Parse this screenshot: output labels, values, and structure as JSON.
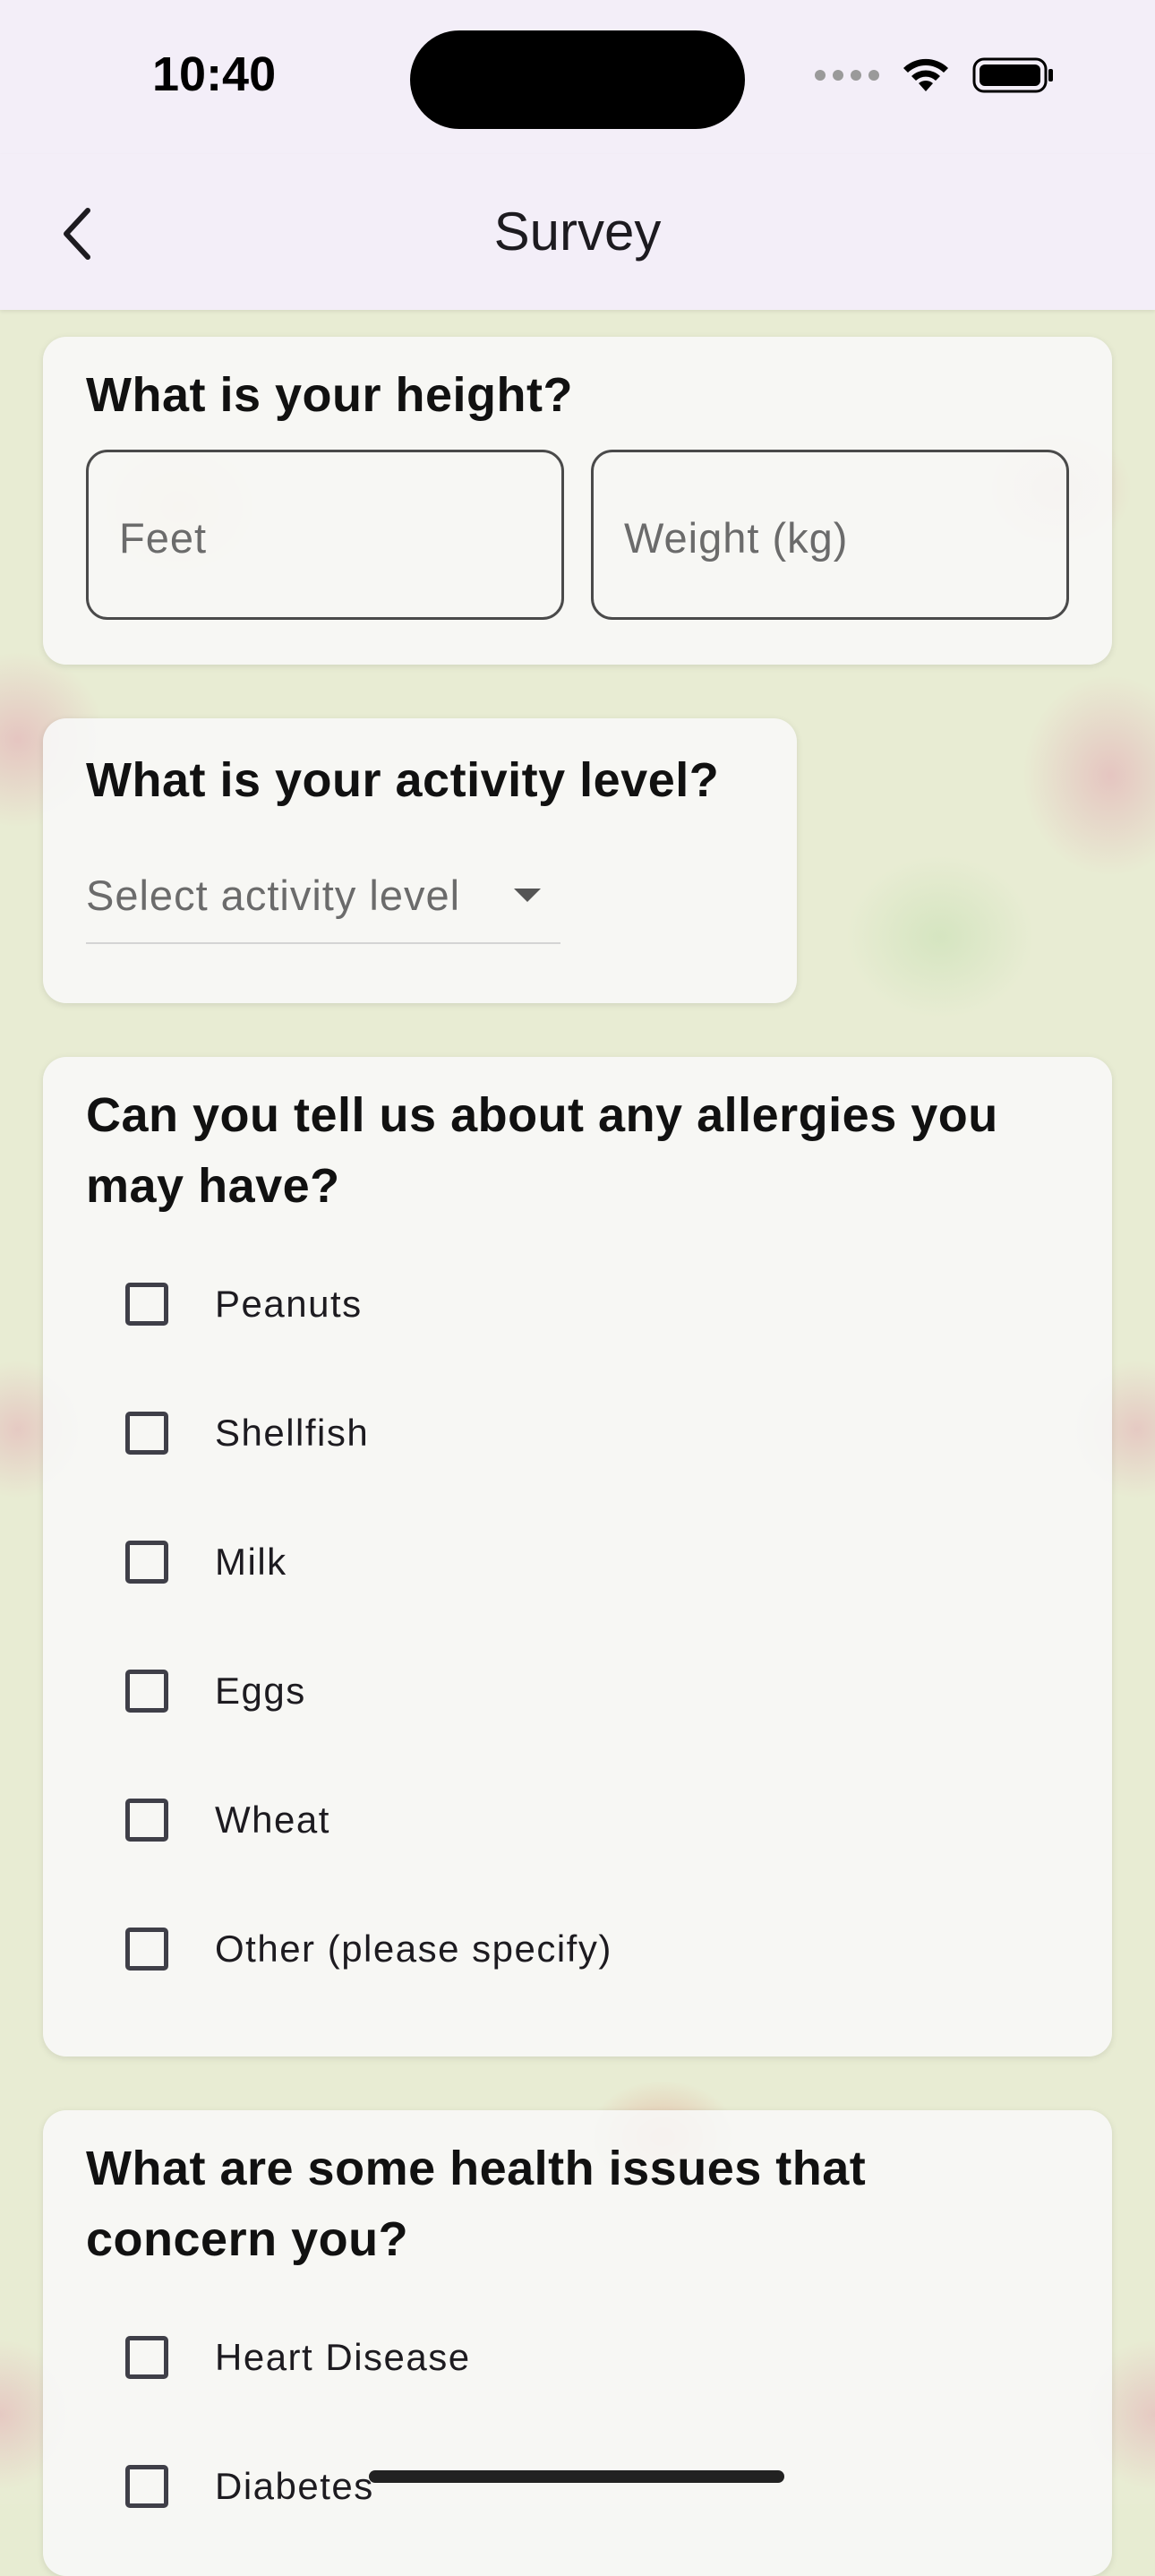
{
  "status": {
    "time": "10:40"
  },
  "nav": {
    "title": "Survey"
  },
  "height_card": {
    "question": "What is your height?",
    "feet_placeholder": "Feet",
    "weight_placeholder": "Weight (kg)"
  },
  "activity_card": {
    "question": "What is your activity level?",
    "dropdown_placeholder": "Select activity level"
  },
  "allergies_card": {
    "question_line1": "Can you tell us about any allergies you",
    "question_line2": "may have?",
    "options": [
      "Peanuts",
      "Shellfish",
      "Milk",
      "Eggs",
      "Wheat",
      "Other (please specify)"
    ]
  },
  "health_card": {
    "question_line1": "What are some health issues that",
    "question_line2": "concern you?",
    "options": [
      "Heart Disease",
      "Diabetes"
    ]
  }
}
